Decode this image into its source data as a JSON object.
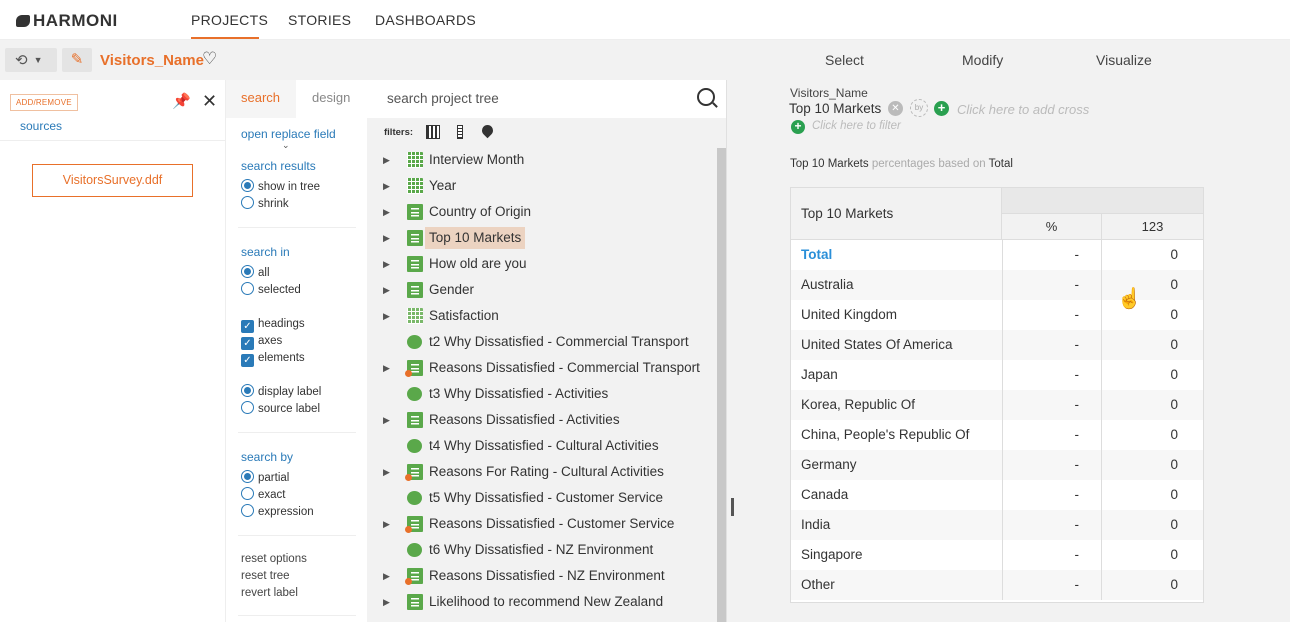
{
  "app": {
    "logo": "HARMONI"
  },
  "nav": {
    "tabs": [
      "PROJECTS",
      "STORIES",
      "DASHBOARDS"
    ]
  },
  "toolbar": {
    "project_name": "Visitors_Name",
    "modes": [
      "Select",
      "Modify",
      "Visualize"
    ]
  },
  "sources": {
    "add_remove": "ADD/REMOVE",
    "link": "sources",
    "file": "VisitorsSurvey.ddf"
  },
  "options": {
    "tab_search": "search",
    "tab_design": "design",
    "open_replace": "open replace field",
    "search_results": "search results",
    "show_in_tree": "show in tree",
    "shrink": "shrink",
    "search_in": "search in",
    "all": "all",
    "selected": "selected",
    "headings": "headings",
    "axes": "axes",
    "elements": "elements",
    "display_label": "display label",
    "source_label": "source label",
    "search_by": "search by",
    "partial": "partial",
    "exact": "exact",
    "expression": "expression",
    "reset_options": "reset options",
    "reset_tree": "reset tree",
    "revert_label": "revert label"
  },
  "tree": {
    "search_placeholder": "search project tree",
    "filters_label": "filters:",
    "items": [
      {
        "label": "Interview Month",
        "icon": "calendar-icon",
        "expand": true
      },
      {
        "label": "Year",
        "icon": "calendar-icon",
        "expand": true
      },
      {
        "label": "Country of Origin",
        "icon": "list-icon",
        "expand": true
      },
      {
        "label": "Top 10 Markets",
        "icon": "list-icon",
        "expand": true,
        "selected": true
      },
      {
        "label": "How old are you",
        "icon": "list-icon",
        "expand": true
      },
      {
        "label": "Gender",
        "icon": "list-icon",
        "expand": true
      },
      {
        "label": "Satisfaction",
        "icon": "grid-icon",
        "expand": true
      },
      {
        "label": "t2 Why Dissatisfied - Commercial Transport",
        "icon": "chat-icon",
        "expand": false
      },
      {
        "label": "Reasons Dissatisfied - Commercial Transport",
        "icon": "multi-list-icon",
        "expand": true
      },
      {
        "label": "t3 Why Dissatisfied - Activities",
        "icon": "chat-icon",
        "expand": false
      },
      {
        "label": "Reasons Dissatisfied - Activities",
        "icon": "list-icon",
        "expand": true
      },
      {
        "label": "t4 Why Dissatisfied - Cultural Activities",
        "icon": "chat-icon",
        "expand": false
      },
      {
        "label": "Reasons For Rating - Cultural Activities",
        "icon": "multi-list-icon",
        "expand": true
      },
      {
        "label": "t5 Why Dissatisfied - Customer Service",
        "icon": "chat-icon",
        "expand": false
      },
      {
        "label": "Reasons Dissatisfied - Customer Service",
        "icon": "multi-list-icon",
        "expand": true
      },
      {
        "label": "t6 Why Dissatisfied - NZ Environment",
        "icon": "chat-icon",
        "expand": false
      },
      {
        "label": "Reasons Dissatisfied - NZ Environment",
        "icon": "multi-list-icon",
        "expand": true
      },
      {
        "label": "Likelihood to recommend New Zealand",
        "icon": "list-icon",
        "expand": true
      }
    ]
  },
  "report": {
    "source": "Visitors_Name",
    "row_var": "Top 10 Markets",
    "by_label": "by",
    "add_cross": "Click here to add cross",
    "add_filter": "Click here to filter",
    "caption_var": "Top 10 Markets",
    "caption_mid": "percentages based on",
    "caption_base": "Total",
    "table": {
      "row_header": "Top 10 Markets",
      "col_pct": "%",
      "col_count": "123",
      "rows": [
        {
          "label": "Total",
          "pct": "-",
          "count": "0"
        },
        {
          "label": "Australia",
          "pct": "-",
          "count": "0"
        },
        {
          "label": "United Kingdom",
          "pct": "-",
          "count": "0"
        },
        {
          "label": "United States Of America",
          "pct": "-",
          "count": "0"
        },
        {
          "label": "Japan",
          "pct": "-",
          "count": "0"
        },
        {
          "label": "Korea, Republic Of",
          "pct": "-",
          "count": "0"
        },
        {
          "label": "China, People's Republic Of",
          "pct": "-",
          "count": "0"
        },
        {
          "label": "Germany",
          "pct": "-",
          "count": "0"
        },
        {
          "label": "Canada",
          "pct": "-",
          "count": "0"
        },
        {
          "label": "India",
          "pct": "-",
          "count": "0"
        },
        {
          "label": "Singapore",
          "pct": "-",
          "count": "0"
        },
        {
          "label": "Other",
          "pct": "-",
          "count": "0"
        }
      ]
    }
  },
  "colors": {
    "accent": "#e8702a",
    "link": "#2a7ab8",
    "green": "#5aa84a"
  }
}
